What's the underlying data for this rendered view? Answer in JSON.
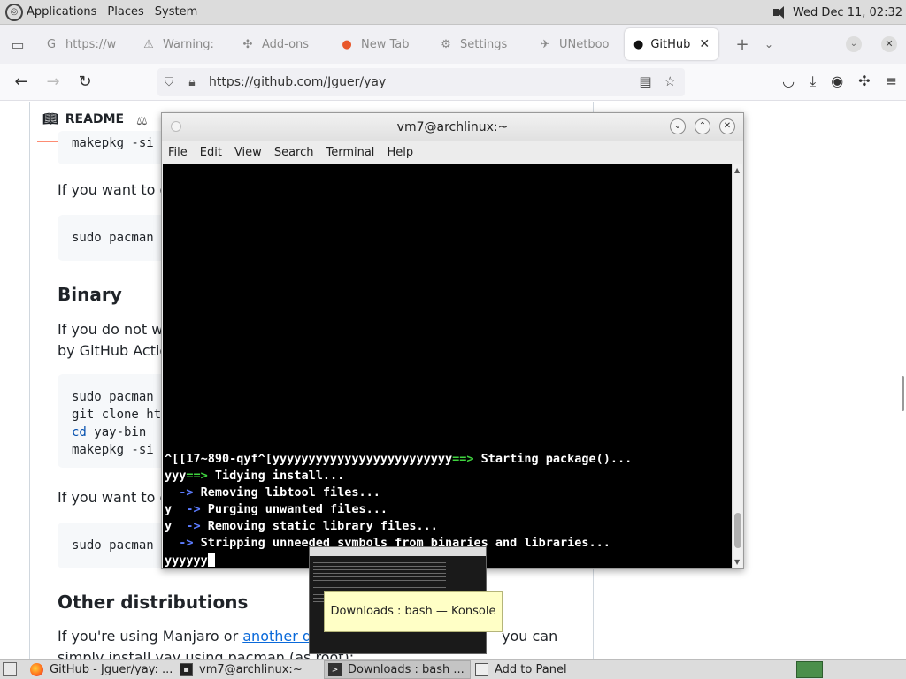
{
  "top_panel": {
    "menus": [
      "Applications",
      "Places",
      "System"
    ],
    "clock": "Wed Dec 11, 02:32"
  },
  "tabs": [
    {
      "label": "https://w",
      "icon": "google-icon",
      "active": false
    },
    {
      "label": "Warning:",
      "icon": "warning-icon",
      "active": false
    },
    {
      "label": "Add-ons",
      "icon": "puzzle-icon",
      "active": false
    },
    {
      "label": "New Tab",
      "icon": "firefox-icon",
      "active": false
    },
    {
      "label": "Settings",
      "icon": "gear-icon",
      "active": false
    },
    {
      "label": "UNetboo",
      "icon": "rocket-icon",
      "active": false
    },
    {
      "label": "GitHub",
      "icon": "github-icon",
      "active": true
    }
  ],
  "url": "https://github.com/Jguer/yay",
  "page": {
    "readme_label": "README",
    "code_top": "makepkg -si",
    "para1": "If you want to d",
    "code2": "sudo pacman -",
    "binary_heading": "Binary",
    "para2_line1": "If you do not wa",
    "para2_line2": "by GitHub Actio",
    "code3": [
      "sudo pacman -",
      "git clone htt",
      "cd",
      " yay-bin",
      "makepkg -si"
    ],
    "para3": "If you want to d",
    "code4": "sudo pacman -",
    "other_heading": "Other distributions",
    "para4_prefix": "If you're using Manjaro or ",
    "para4_link": "another dis",
    "para4_suffix": "you can",
    "para4_line2": "simply install yay using pacman (as root):"
  },
  "terminal": {
    "title": "vm7@archlinux:~",
    "menu": [
      "File",
      "Edit",
      "View",
      "Search",
      "Terminal",
      "Help"
    ],
    "lines": [
      {
        "pre": "^[[17~890-qyf^[yyyyyyyyyyyyyyyyyyyyyyyyy",
        "arrow": "==>",
        "text": " Starting package()..."
      },
      {
        "pre": "yyy",
        "arrow": "==>",
        "text": " Tidying install..."
      },
      {
        "pre": "  ",
        "arrow": "->",
        "text": " Removing libtool files..."
      },
      {
        "pre": "y  ",
        "arrow": "->",
        "text": " Purging unwanted files..."
      },
      {
        "pre": "y  ",
        "arrow": "->",
        "text": " Removing static library files..."
      },
      {
        "pre": "  ",
        "arrow": "->",
        "text": " Stripping unneeded symbols from binaries and libraries..."
      }
    ],
    "prompt_line": "yyyyyy"
  },
  "tooltip": "Downloads : bash — Konsole",
  "taskbar": [
    {
      "label": "GitHub - Jguer/yay: ...",
      "icon": "firefox-icon"
    },
    {
      "label": "vm7@archlinux:~",
      "icon": "terminal-icon"
    },
    {
      "label": "Downloads : bash ...",
      "icon": "konsole-icon"
    },
    {
      "label": "Add to Panel",
      "icon": "panel-icon"
    }
  ]
}
